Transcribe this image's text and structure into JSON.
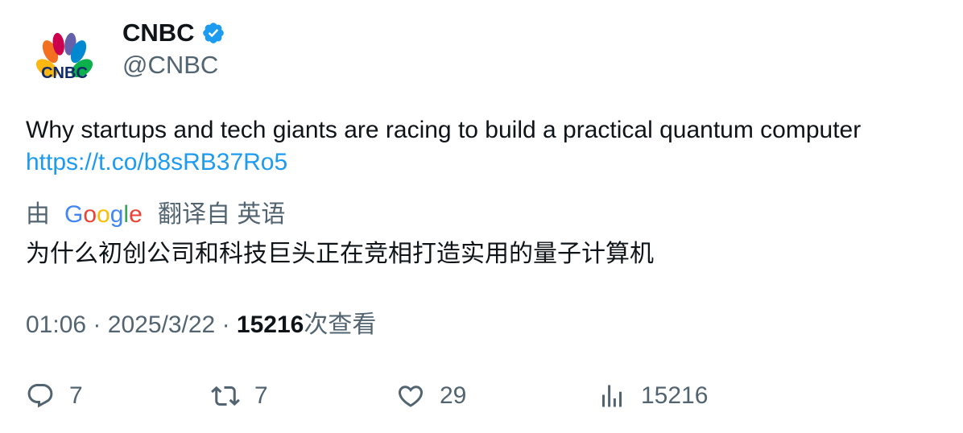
{
  "author": {
    "display_name": "CNBC",
    "handle": "@CNBC",
    "avatar_icon": "cnbc-peacock-logo",
    "logo_text": "CNBC",
    "verified_icon": "verified-badge-icon",
    "verified_color": "#1d9bf0"
  },
  "tweet": {
    "text": "Why startups and tech giants are racing to build a practical quantum computer",
    "link": "https://t.co/b8sRB37Ro5"
  },
  "translation": {
    "prefix": "由",
    "provider_icon": "google-logo",
    "suffix": "翻译自 英语",
    "text": "为什么初创公司和科技巨头正在竞相打造实用的量子计算机"
  },
  "meta": {
    "time": "01:06",
    "separator": "·",
    "date": "2025/3/22",
    "views_count": "15216",
    "views_label": "次查看"
  },
  "actions": {
    "reply_count": "7",
    "retweet_count": "7",
    "like_count": "29",
    "views_count": "15216"
  },
  "colors": {
    "link": "#1d9bf0",
    "secondary_text": "#536471",
    "primary_text": "#0f1419"
  }
}
